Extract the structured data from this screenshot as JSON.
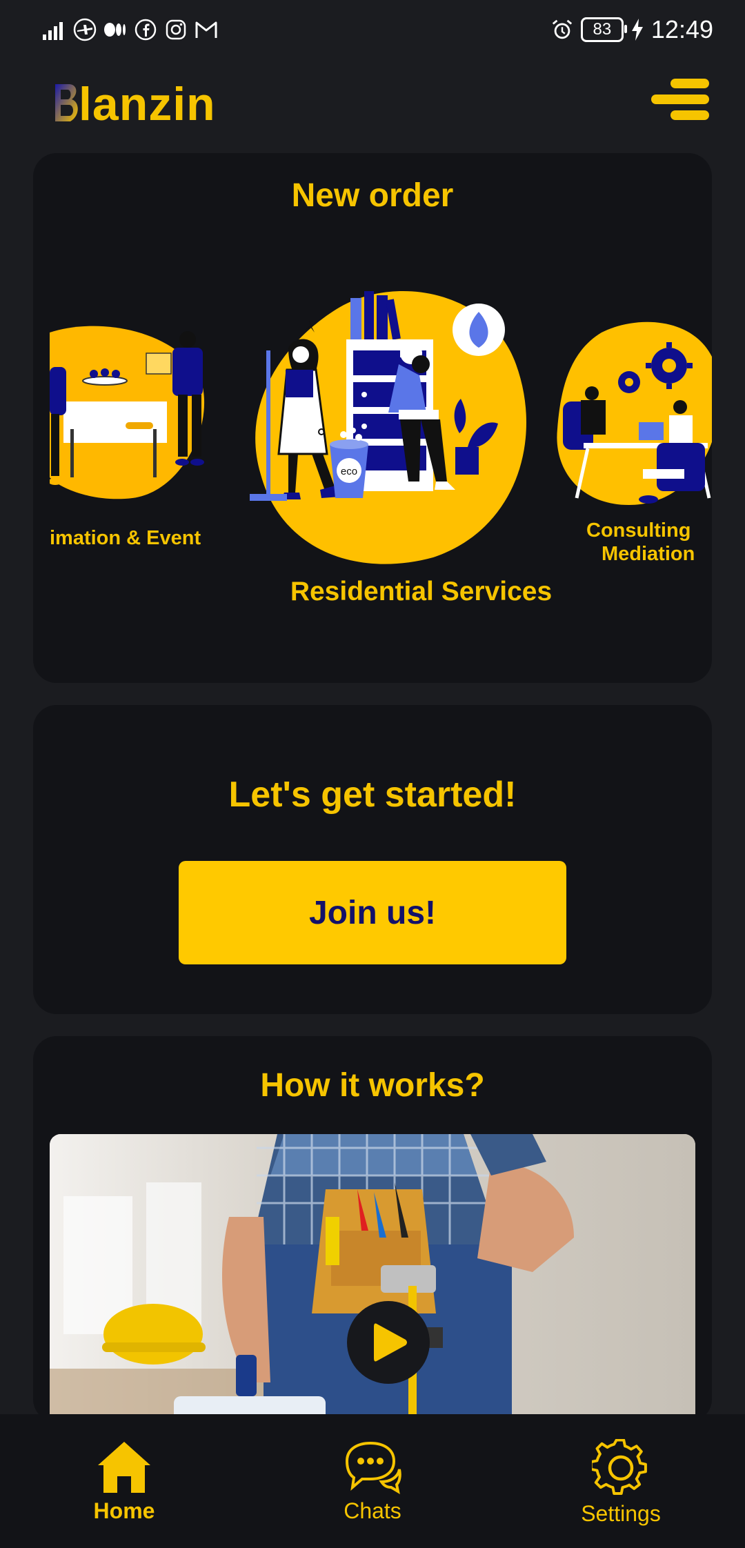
{
  "status_bar": {
    "time": "12:49",
    "battery": "83",
    "left_icons": [
      "signal-icon",
      "plane-badge-icon",
      "medium-icon",
      "facebook-icon",
      "instagram-icon",
      "gmail-icon"
    ],
    "right_icons": [
      "alarm-icon",
      "battery-icon",
      "charging-icon"
    ]
  },
  "header": {
    "logo_text": "lanzin"
  },
  "new_order": {
    "title": "New order",
    "items": [
      {
        "label": "imation & Event"
      },
      {
        "label": "Residential Services"
      },
      {
        "label_line1": "Consulting",
        "label_line2": "Mediation"
      }
    ]
  },
  "get_started": {
    "title": "Let's get started!",
    "button": "Join us!"
  },
  "how_it_works": {
    "title": "How it works?"
  },
  "nav": {
    "items": [
      {
        "label": "Home",
        "icon": "home-icon"
      },
      {
        "label": "Chats",
        "icon": "chat-icon"
      },
      {
        "label": "Settings",
        "icon": "gear-icon"
      }
    ]
  },
  "colors": {
    "accent": "#f6c400",
    "button_bg": "#ffc900",
    "button_text": "#13116a",
    "card_bg": "#121317",
    "page_bg": "#1b1c20",
    "illustration_blue": "#0f0f8c",
    "illustration_light_blue": "#5a76e8"
  }
}
